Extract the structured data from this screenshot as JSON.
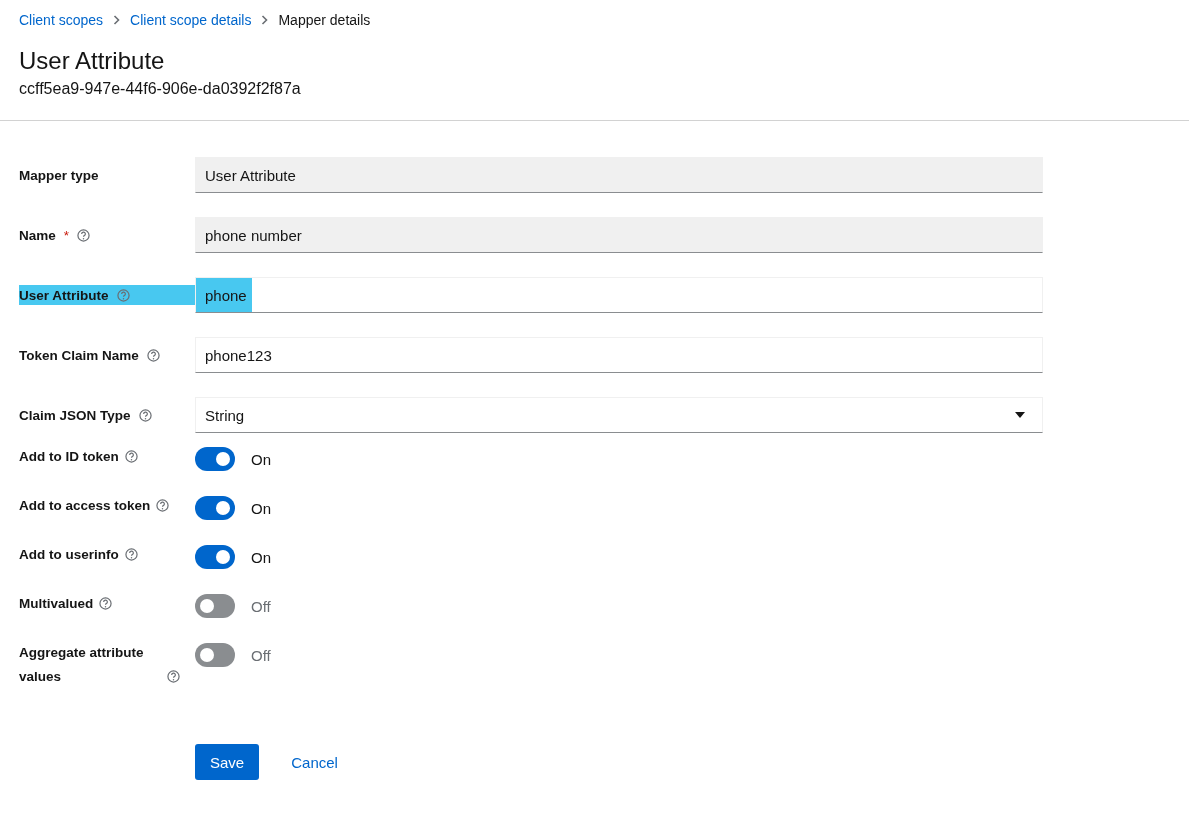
{
  "breadcrumb": [
    {
      "label": "Client scopes",
      "link": true
    },
    {
      "label": "Client scope details",
      "link": true
    },
    {
      "label": "Mapper details",
      "link": false
    }
  ],
  "title": "User Attribute",
  "subtitle": "ccff5ea9-947e-44f6-906e-da0392f2f87a",
  "fields": [
    {
      "kind": "readonly",
      "label": "Mapper type",
      "help": false,
      "value": "User Attribute",
      "highlighted": false
    },
    {
      "kind": "readonly",
      "label": "Name",
      "required_mark": "*",
      "help": true,
      "value": "phone number",
      "highlighted": false
    },
    {
      "kind": "text",
      "label": "User Attribute",
      "help": true,
      "value": "phone",
      "highlighted": true
    },
    {
      "kind": "text",
      "label": "Token Claim Name",
      "help": true,
      "value": "phone123",
      "highlighted": false
    },
    {
      "kind": "select",
      "label": "Claim JSON Type",
      "help": true,
      "value": "String",
      "highlighted": false
    },
    {
      "kind": "switch",
      "label": "Add to ID token",
      "help": true,
      "on": true,
      "state_text": "On",
      "highlighted": false
    },
    {
      "kind": "switch",
      "label": "Add to access token",
      "help": true,
      "on": true,
      "state_text": "On",
      "highlighted": false
    },
    {
      "kind": "switch",
      "label": "Add to userinfo",
      "help": true,
      "on": true,
      "state_text": "On",
      "highlighted": false
    },
    {
      "kind": "switch",
      "label": "Multivalued",
      "help": true,
      "on": false,
      "state_text": "Off",
      "highlighted": false
    },
    {
      "kind": "switch",
      "label": "Aggregate attribute values",
      "help": true,
      "on": false,
      "state_text": "Off",
      "highlighted": false
    }
  ],
  "buttons": [
    {
      "kind": "primary",
      "label": "Save"
    },
    {
      "kind": "link",
      "label": "Cancel"
    }
  ]
}
